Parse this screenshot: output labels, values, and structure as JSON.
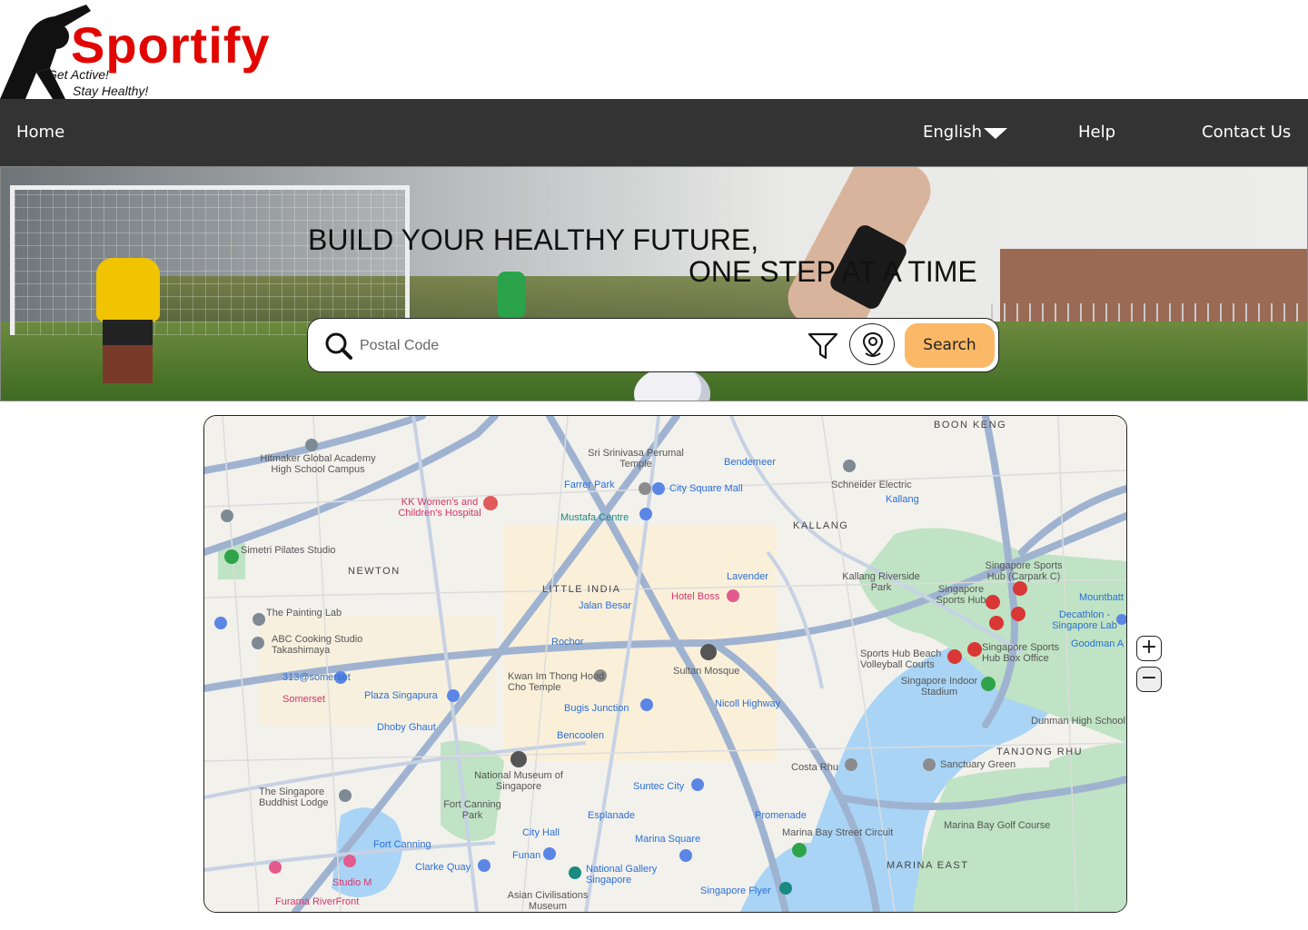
{
  "brand": {
    "name": "Sportify",
    "tagline_line1": "Get Active!",
    "tagline_line2": "Stay Healthy!"
  },
  "nav": {
    "home": "Home",
    "language": "English",
    "help": "Help",
    "contact": "Contact Us"
  },
  "hero": {
    "headline_line1": "BUILD YOUR HEALTHY FUTURE,",
    "headline_line2": "ONE STEP AT A TIME"
  },
  "search": {
    "placeholder": "Postal Code",
    "button": "Search"
  },
  "map": {
    "areas": [
      "NEWTON",
      "LITTLE INDIA",
      "KALLANG",
      "BOON KENG",
      "TANJONG RHU",
      "MARINA EAST"
    ],
    "places": [
      "Hitmaker Global Academy High School Campus",
      "Sri Srinivasa Perumal Temple",
      "Bendemeer",
      "Schneider Electric",
      "KK Women's and Children's Hospital",
      "Farrer Park",
      "City Square Mall",
      "Kallang",
      "Mustafa Centre",
      "Simetri Pilates Studio",
      "Jalan Besar",
      "Lavender",
      "Kallang Riverside Park",
      "Singapore Sports Hub (Carpark C)",
      "Singapore Sports Hub",
      "Hotel Boss",
      "The Painting Lab",
      "Decathlon - Singapore Lab",
      "ABC Cooking Studio Takashimaya",
      "Rochor",
      "Sultan Mosque",
      "Sports Hub Beach Volleyball Courts",
      "Singapore Sports Hub Box Office",
      "313@somerset",
      "Kwan Im Thong Hood Cho Temple",
      "Singapore Indoor Stadium",
      "Somerset",
      "Plaza Singapura",
      "Bugis Junction",
      "Nicoll Highway",
      "Dhoby Ghaut",
      "Bencoolen",
      "Dunman High School",
      "National Museum of Singapore",
      "Costa Rhu",
      "Sanctuary Green",
      "The Singapore Buddhist Lodge",
      "Fort Canning Park",
      "Suntec City",
      "Esplanade",
      "Promenade",
      "Marina Bay Golf Course",
      "Fort Canning",
      "City Hall",
      "Marina Square",
      "Marina Bay Street Circuit",
      "Clarke Quay",
      "Funan",
      "National Gallery Singapore",
      "Studio M",
      "Singapore Flyer",
      "Furama RiverFront",
      "Asian Civilisations Museum",
      "Goodman A",
      "Mountbatt"
    ],
    "zoom_in": "+",
    "zoom_out": "−"
  },
  "colors": {
    "nav_bg": "#333333",
    "brand_red": "#e10600",
    "search_button": "#fbb866",
    "water": "#a9d4f5",
    "park": "#bfe3c4"
  }
}
